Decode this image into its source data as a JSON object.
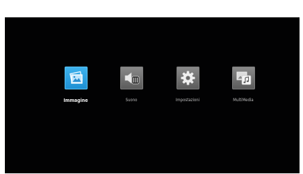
{
  "menu": {
    "items": [
      {
        "label": "Immagine",
        "icon": "picture-icon",
        "selected": true
      },
      {
        "label": "Suono",
        "icon": "speaker-icon",
        "selected": false
      },
      {
        "label": "Impostazioni",
        "icon": "gear-icon",
        "selected": false
      },
      {
        "label": "MultiMedia",
        "icon": "multimedia-icon",
        "selected": false
      }
    ]
  },
  "colors": {
    "background": "#020203",
    "selected_tile": "#2aa2e2",
    "tile": "#707070"
  }
}
